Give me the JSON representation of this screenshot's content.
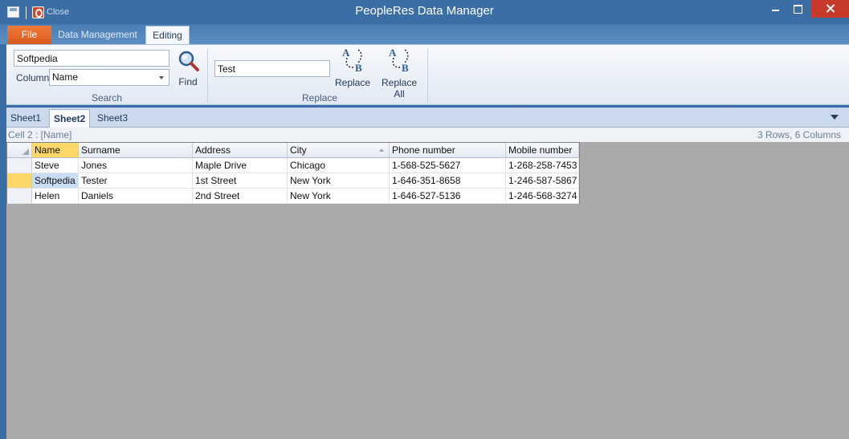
{
  "app": {
    "title": "PeopleRes Data Manager",
    "quick_access": {
      "close_label": "Close"
    }
  },
  "ribbon": {
    "tabs": [
      {
        "label": "File"
      },
      {
        "label": "Data Management"
      },
      {
        "label": "Editing"
      }
    ],
    "search_group": {
      "search_value": "Softpedia",
      "column_label": "Column",
      "column_value": "Name",
      "find_label": "Find",
      "group_label": "Search"
    },
    "replace_group": {
      "replace_value": "Test",
      "replace_label": "Replace",
      "replace_all_label": "Replace All",
      "group_label": "Replace"
    }
  },
  "sheets": {
    "tabs": [
      {
        "label": "Sheet1"
      },
      {
        "label": "Sheet2"
      },
      {
        "label": "Sheet3"
      }
    ],
    "active": "Sheet2"
  },
  "status": {
    "cell": "Cell 2 : [Name]",
    "summary": "3 Rows, 6 Columns"
  },
  "grid": {
    "columns": [
      "Name",
      "Surname",
      "Address",
      "City",
      "Phone number",
      "Mobile number"
    ],
    "rows": [
      [
        "Steve",
        "Jones",
        "Maple Drive",
        "Chicago",
        "1-568-525-5627",
        "1-268-258-7453"
      ],
      [
        "Softpedia",
        "Tester",
        "1st Street",
        "New York",
        "1-646-351-8658",
        "1-246-587-5867"
      ],
      [
        "Helen",
        "Daniels",
        "2nd Street",
        "New York",
        "1-646-527-5136",
        "1-246-568-3274"
      ]
    ]
  },
  "colors": {
    "window_frame": "#3b6ea5",
    "file_tab": "#e8692a",
    "selection": "#fbd768",
    "active_cell": "#c9def5",
    "empty_grid": "#aaaaaa"
  }
}
